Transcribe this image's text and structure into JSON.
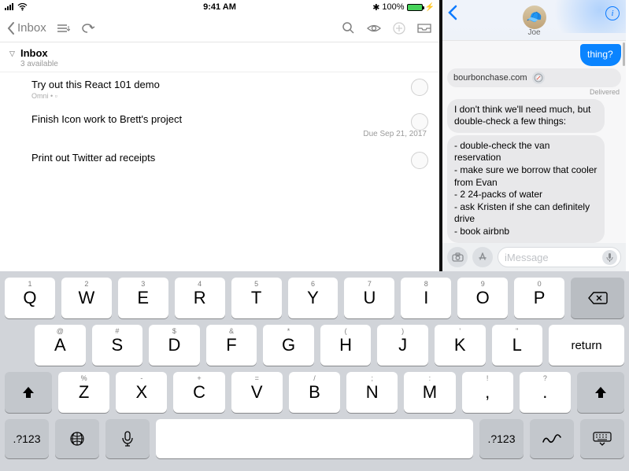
{
  "status": {
    "time": "9:41 AM",
    "battery": "100%",
    "bluetooth": "✱"
  },
  "omni": {
    "back_label": "Inbox",
    "section": {
      "title": "Inbox",
      "subtitle": "3 available"
    },
    "items": [
      {
        "title": "Try out this React 101 demo",
        "sub": "Omni • ▫",
        "due": ""
      },
      {
        "title": "Finish Icon work to Brett's project",
        "sub": "",
        "due": "Due Sep 21, 2017"
      },
      {
        "title": "Print out Twitter ad receipts",
        "sub": "",
        "due": ""
      }
    ]
  },
  "messages": {
    "contact": "Joe",
    "outgoing_tail": "thing?",
    "rich_link": "bourbonchase.com",
    "delivered": "Delivered",
    "incoming1": "I don't think we'll need much, but double-check a few things:",
    "incoming2": "- double-check the van reservation\n- make sure we borrow that cooler from Evan\n- 2 24-packs of water\n- ask Kristen if she can definitely drive\n- book airbnb",
    "placeholder": "iMessage"
  },
  "keyboard": {
    "row1_hints": [
      "1",
      "2",
      "3",
      "4",
      "5",
      "6",
      "7",
      "8",
      "9",
      "0"
    ],
    "row1": [
      "Q",
      "W",
      "E",
      "R",
      "T",
      "Y",
      "U",
      "I",
      "O",
      "P"
    ],
    "row2_hints": [
      "@",
      "#",
      "$",
      "&",
      "*",
      "(",
      ")",
      "'",
      "\""
    ],
    "row2": [
      "A",
      "S",
      "D",
      "F",
      "G",
      "H",
      "J",
      "K",
      "L"
    ],
    "return": "return",
    "row3_hints": [
      "%",
      "-",
      "+",
      "=",
      "/",
      ";",
      ":",
      "!",
      "?"
    ],
    "row3": [
      "Z",
      "X",
      "C",
      "V",
      "B",
      "N",
      "M",
      ",",
      "."
    ],
    "numkey": ".?123"
  }
}
